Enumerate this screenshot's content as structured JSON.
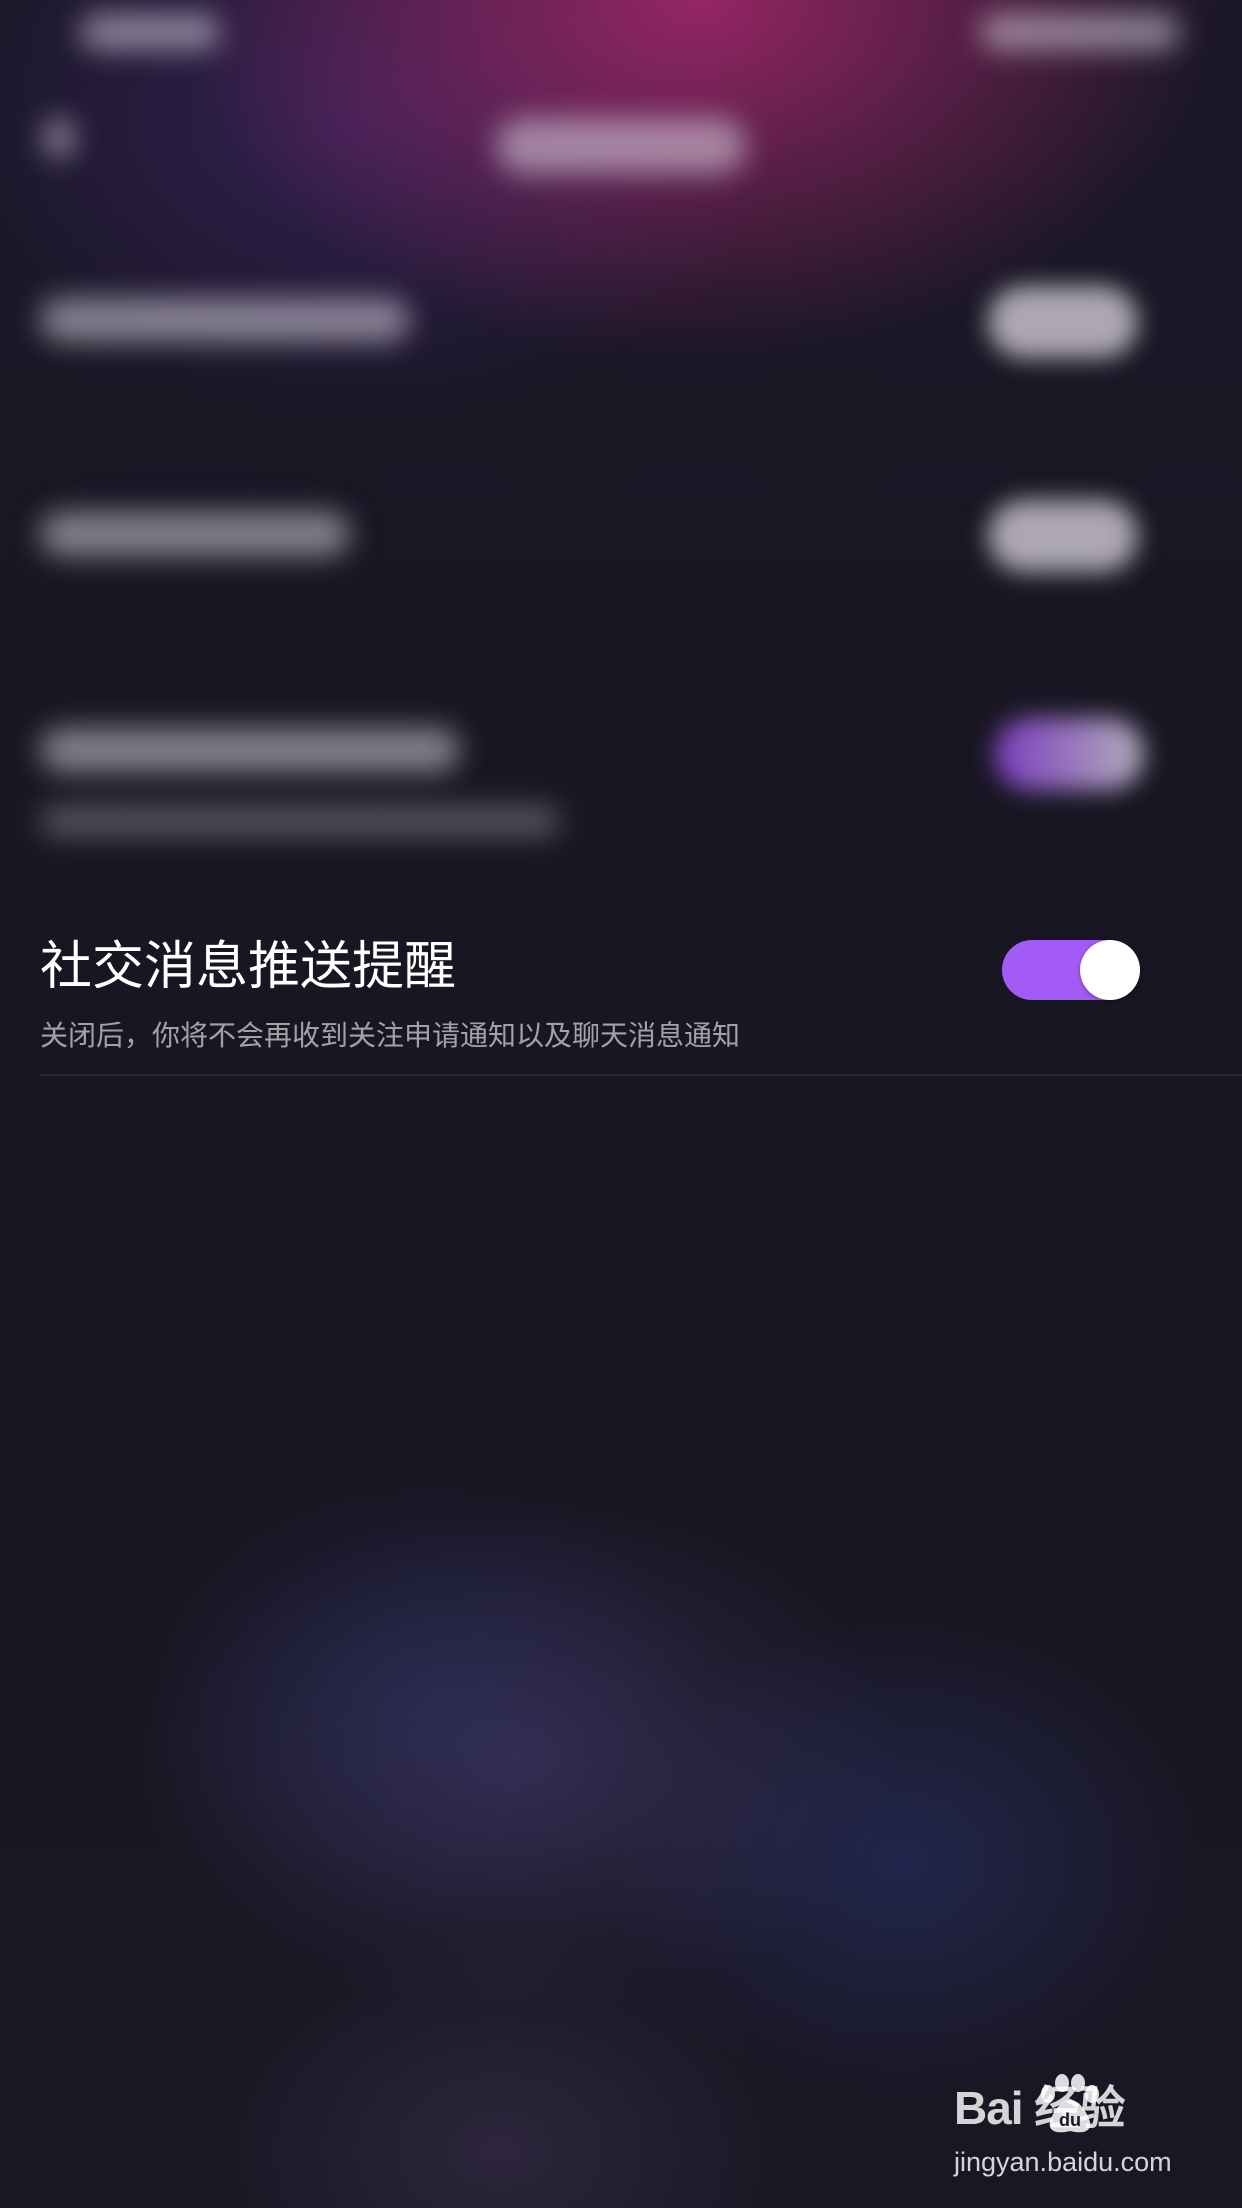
{
  "social_notification": {
    "title": "社交消息推送提醒",
    "subtitle": "关闭后，你将不会再收到关注申请通知以及聊天消息通知",
    "enabled": true,
    "toggle_color": "#a35bf6"
  },
  "watermark": {
    "logo_text": "Bai 经验",
    "url": "jingyan.baidu.com"
  }
}
